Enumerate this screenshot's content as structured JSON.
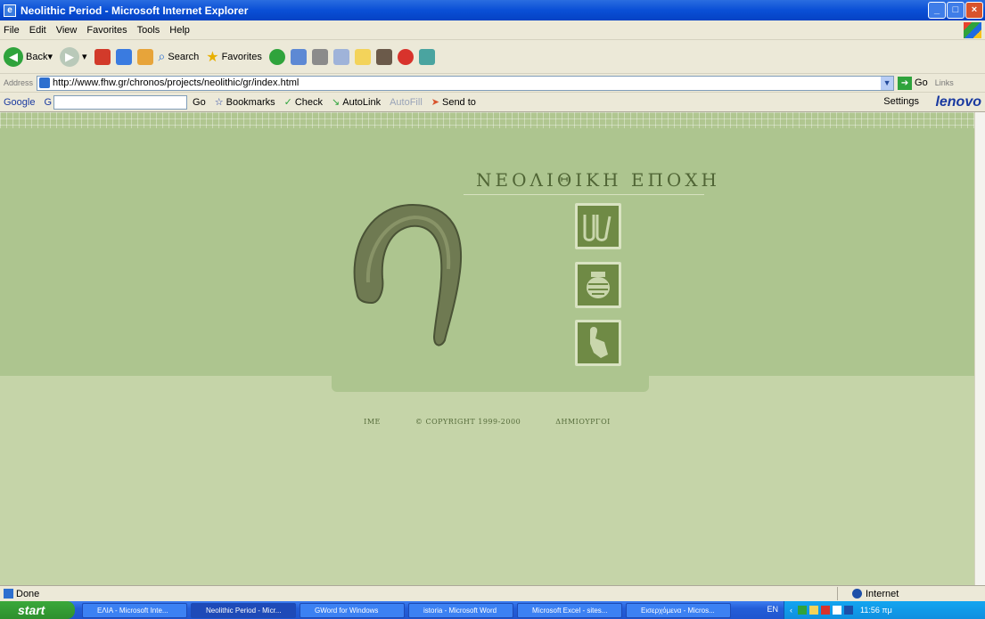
{
  "window": {
    "title": "Neolithic Period - Microsoft Internet Explorer"
  },
  "menu": [
    "File",
    "Edit",
    "View",
    "Favorites",
    "Tools",
    "Help"
  ],
  "toolbar": {
    "back": "Back",
    "search": "Search",
    "favorites": "Favorites"
  },
  "address": {
    "label": "Address",
    "url": "http://www.fhw.gr/chronos/projects/neolithic/gr/index.html",
    "go": "Go",
    "links": "Links"
  },
  "googlebar": {
    "logo": "Google",
    "g_label": "G",
    "go": "Go",
    "bookmarks": "Bookmarks",
    "check": "Check",
    "autolink": "AutoLink",
    "autofill": "AutoFill",
    "sendto": "Send to",
    "settings": "Settings",
    "brand": "lenovo"
  },
  "page": {
    "title": "ΝΕΟΛΙΘΙΚΗ ΕΠΟΧΗ",
    "nav_icons": [
      "tools-icon",
      "pottery-icon",
      "figurine-icon"
    ],
    "footer": {
      "ime": "ΙΜΕ",
      "copyright": "© COPYRIGHT 1999-2000",
      "credits": "ΔΗΜΙΟΥΡΓΟΙ"
    }
  },
  "status": {
    "text": "Done",
    "zone": "Internet"
  },
  "taskbar": {
    "start": "start",
    "tasks": [
      "ΕΛΙΑ - Microsoft Inte...",
      "Neolithic Period - Micr...",
      "GWord for Windows",
      "istoria - Microsoft Word",
      "Microsoft Excel - sites...",
      "Εισερχόμενα - Micros..."
    ],
    "lang": "EN",
    "clock": "11:56 πμ"
  }
}
